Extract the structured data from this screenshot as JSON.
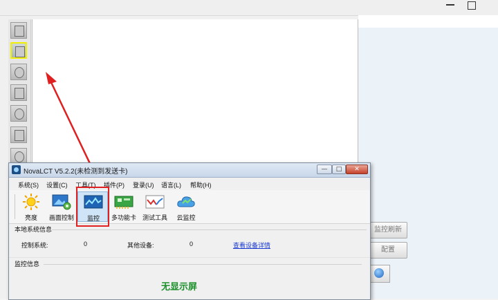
{
  "dialog": {
    "title": "NovaLCT V5.2.2(未检测到发送卡)",
    "menu": [
      "系统(S)",
      "设置(C)",
      "工具(T)",
      "插件(P)",
      "登录(U)",
      "语言(L)",
      "帮助(H)"
    ],
    "toolbar": [
      {
        "label": "亮度",
        "icon": "brightness-icon"
      },
      {
        "label": "画面控制",
        "icon": "screen-control-icon"
      },
      {
        "label": "监控",
        "icon": "monitor-icon",
        "selected": true
      },
      {
        "label": "多功能卡",
        "icon": "multifunction-card-icon"
      },
      {
        "label": "测试工具",
        "icon": "test-tool-icon"
      },
      {
        "label": "云监控",
        "icon": "cloud-monitor-icon"
      }
    ],
    "local_info": {
      "heading": "本地系统信息",
      "control_system_label": "控制系统:",
      "control_system_value": "0",
      "other_devices_label": "其他设备:",
      "other_devices_value": "0",
      "details_link": "查看设备详情"
    },
    "monitor_info": {
      "heading": "监控信息",
      "status": "无显示屏"
    }
  },
  "background": {
    "refresh_button": "监控刷新",
    "config_button": "配置"
  },
  "colors": {
    "highlight": "#e02020",
    "active_tool_border": "#f1ef00",
    "status_green": "#1b8f2a",
    "link_blue": "#1a3ad1"
  }
}
